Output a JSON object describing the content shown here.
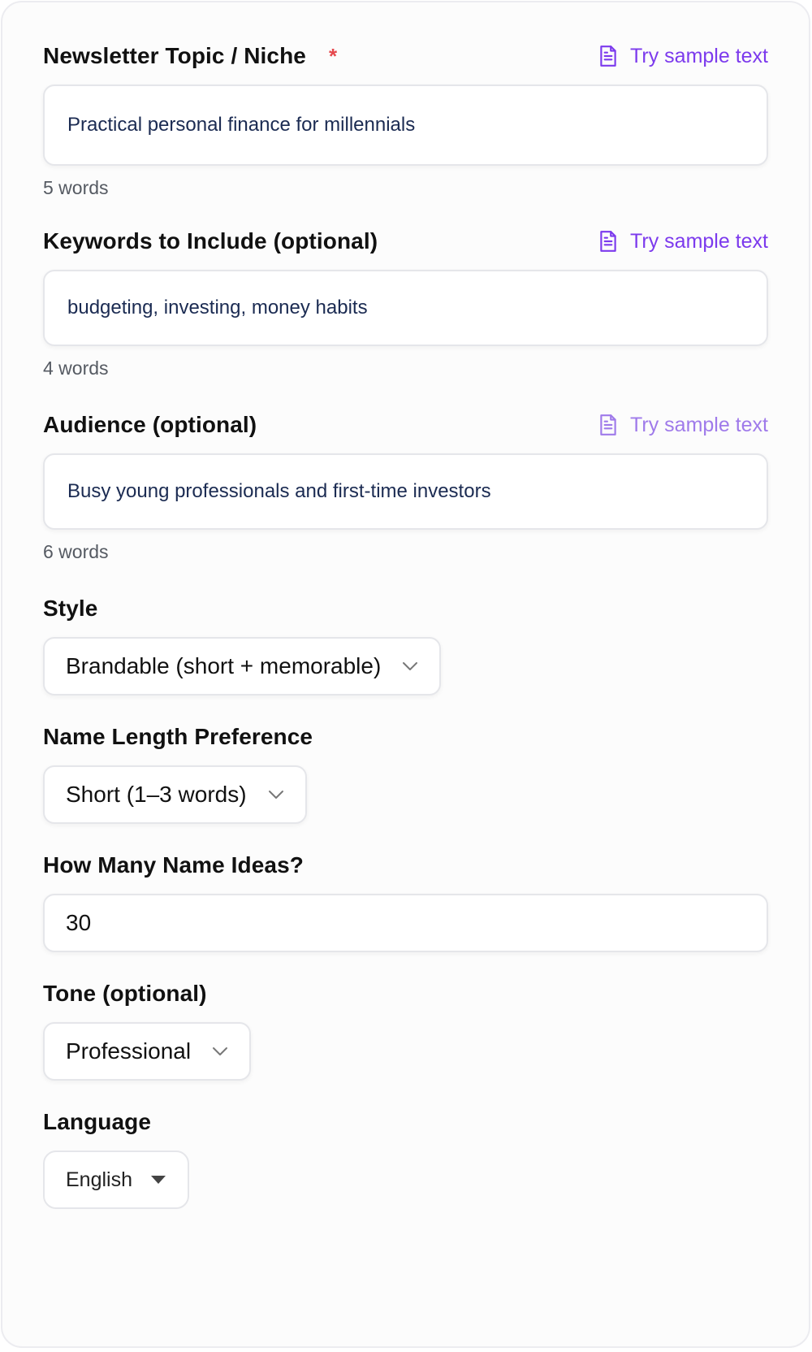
{
  "fields": {
    "topic": {
      "label": "Newsletter Topic / Niche",
      "required_mark": "*",
      "sample_link": "Try sample text",
      "value": "Practical personal finance for millennials",
      "word_count": "5 words"
    },
    "keywords": {
      "label": "Keywords to Include (optional)",
      "sample_link": "Try sample text",
      "value": "budgeting, investing, money habits",
      "word_count": "4 words"
    },
    "audience": {
      "label": "Audience (optional)",
      "sample_link": "Try sample text",
      "value": "Busy young professionals and first-time investors",
      "word_count": "6 words"
    },
    "style": {
      "label": "Style",
      "selected": "Brandable (short + memorable)"
    },
    "name_length": {
      "label": "Name Length Preference",
      "selected": "Short (1–3 words)"
    },
    "count": {
      "label": "How Many Name Ideas?",
      "value": "30"
    },
    "tone": {
      "label": "Tone (optional)",
      "selected": "Professional"
    },
    "language": {
      "label": "Language",
      "selected": "English"
    }
  },
  "colors": {
    "accent": "#7c3aed",
    "required": "#e5484d",
    "input_text": "#1b2b52",
    "muted": "#555a62"
  },
  "icons": {
    "sample": "document-icon",
    "dropdown": "chevron-down-icon",
    "native_dropdown": "caret-down-icon"
  }
}
